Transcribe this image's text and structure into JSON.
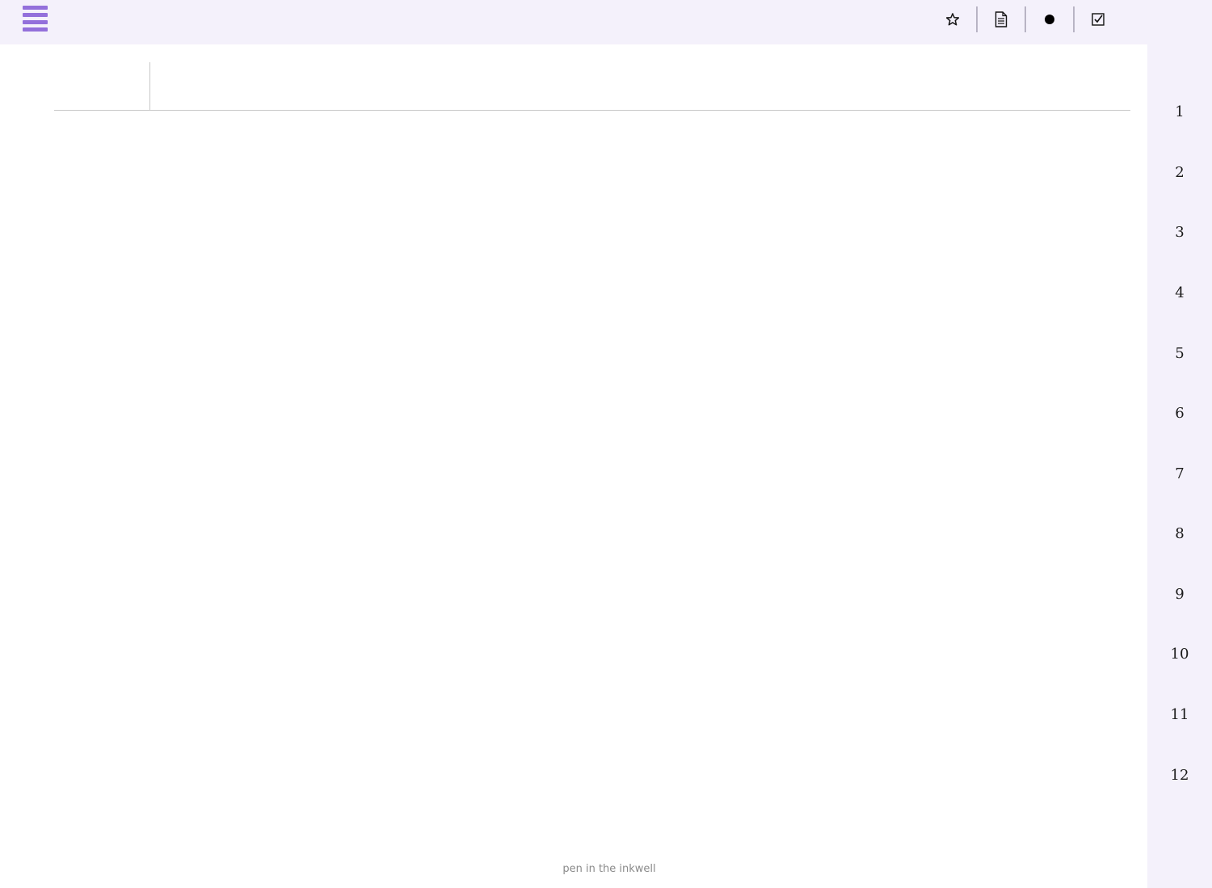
{
  "header": {
    "menu_icon": "hamburger-icon",
    "accent_color": "#9370db",
    "toolbar": [
      {
        "name": "star-button",
        "icon": "star-icon",
        "glyph": "☆"
      },
      {
        "name": "document-button",
        "icon": "document-icon",
        "glyph": "🗎"
      },
      {
        "name": "record-button",
        "icon": "filled-circle-icon",
        "glyph": "●"
      },
      {
        "name": "checkbox-button",
        "icon": "checked-box-icon",
        "glyph": "☑"
      }
    ]
  },
  "sidebar": {
    "pages": [
      "1",
      "2",
      "3",
      "4",
      "5",
      "6",
      "7",
      "8",
      "9",
      "10",
      "11",
      "12"
    ]
  },
  "editor": {
    "title_value": ""
  },
  "footer": {
    "text": "pen in the inkwell"
  }
}
